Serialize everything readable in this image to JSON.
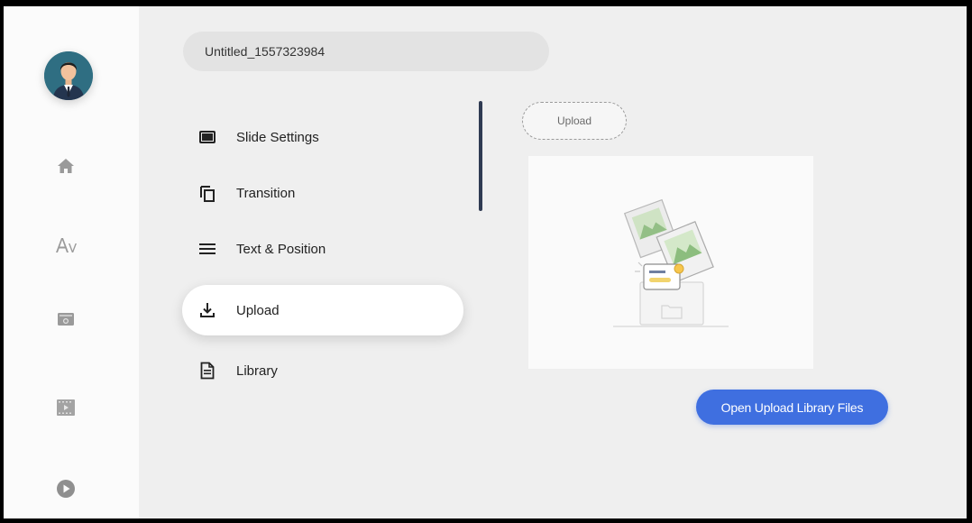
{
  "project": {
    "title": "Untitled_1557323984"
  },
  "rail": {
    "icons": [
      "avatar",
      "home-icon",
      "text-style-icon",
      "media-box-icon",
      "video-icon",
      "play-icon"
    ]
  },
  "menu": {
    "items": [
      {
        "label": "Slide Settings",
        "icon": "slide-settings-icon"
      },
      {
        "label": "Transition",
        "icon": "transition-icon"
      },
      {
        "label": "Text & Position",
        "icon": "text-position-icon"
      },
      {
        "label": "Upload",
        "icon": "upload-icon",
        "active": true
      },
      {
        "label": "Library",
        "icon": "library-icon"
      }
    ]
  },
  "upload_panel": {
    "chip_label": "Upload",
    "button_label": "Open Upload Library Files"
  },
  "colors": {
    "accent": "#3f6fe0",
    "indicator": "#2f3a52",
    "background": "#efefef"
  }
}
